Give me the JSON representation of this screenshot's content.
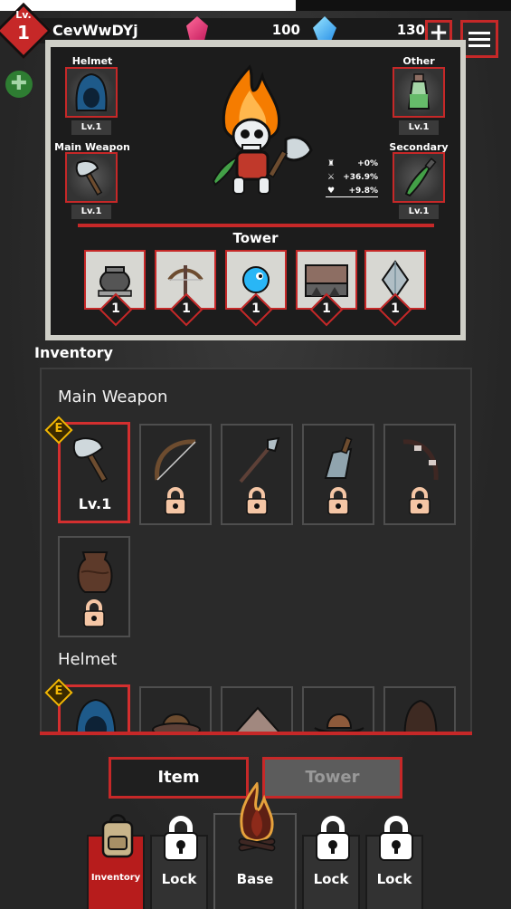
{
  "player": {
    "level_label": "Lv.",
    "level": "1",
    "name": "CevWwDYj"
  },
  "currency": {
    "red_gems": "100",
    "blue_gems": "130"
  },
  "icons": {
    "plus": "plus-icon",
    "menu": "menu-icon",
    "gear": "gear-icon",
    "red_gem": "red-gem-icon",
    "blue_gem": "blue-gem-icon",
    "lock": "lock-icon"
  },
  "equipment": {
    "helmet": {
      "label": "Helmet",
      "level": "Lv.1"
    },
    "main_weapon": {
      "label": "Main Weapon",
      "level": "Lv.1"
    },
    "other": {
      "label": "Other",
      "level": "Lv.1"
    },
    "secondary": {
      "label": "Secondary",
      "level": "Lv.1"
    }
  },
  "stats": [
    {
      "icon": "tower-icon",
      "value": "+0%"
    },
    {
      "icon": "swords-icon",
      "value": "+36.9%"
    },
    {
      "icon": "heart-icon",
      "value": "+9.8%"
    }
  ],
  "tower": {
    "title": "Tower",
    "slots": [
      {
        "icon": "pot-icon",
        "count": "1"
      },
      {
        "icon": "crossbow-icon",
        "count": "1"
      },
      {
        "icon": "blue-creature-icon",
        "count": "1"
      },
      {
        "icon": "spike-trap-icon",
        "count": "1"
      },
      {
        "icon": "crystal-icon",
        "count": "1"
      }
    ]
  },
  "inventory": {
    "title": "Inventory",
    "equipped_badge": "E",
    "categories": [
      {
        "name": "Main Weapon",
        "items": [
          {
            "icon": "axe-icon",
            "level": "Lv.1"
          },
          {
            "icon": "bow-icon"
          },
          {
            "icon": "spear-icon"
          },
          {
            "icon": "cleaver-icon"
          },
          {
            "icon": "wrapped-bow-icon"
          },
          {
            "icon": "urn-icon"
          }
        ]
      },
      {
        "name": "Helmet",
        "items": [
          {
            "icon": "blue-hood-icon"
          },
          {
            "icon": "brown-hat-icon"
          },
          {
            "icon": "straw-hat-icon"
          },
          {
            "icon": "cowboy-hat-icon"
          },
          {
            "icon": "dark-hood-icon"
          }
        ]
      }
    ]
  },
  "tabs": {
    "item": "Item",
    "tower": "Tower"
  },
  "bottom_nav": [
    {
      "label": "Inventory",
      "icon": "backpack-icon",
      "state": "active"
    },
    {
      "label": "Lock",
      "icon": "lock-icon",
      "state": "locked"
    },
    {
      "label": "Base",
      "icon": "campfire-icon",
      "state": "normal"
    },
    {
      "label": "Lock",
      "icon": "lock-icon",
      "state": "locked"
    },
    {
      "label": "Lock",
      "icon": "lock-icon",
      "state": "locked"
    }
  ],
  "colors": {
    "accent_red": "#c62828",
    "equipped_gold": "#f2b705",
    "panel_dark": "#1c1c1c"
  }
}
